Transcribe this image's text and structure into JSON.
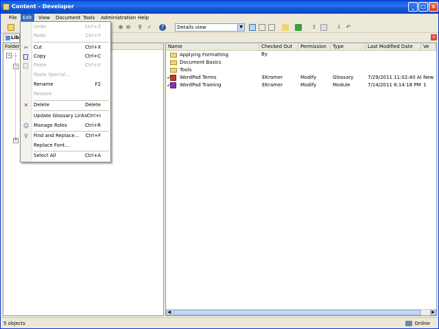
{
  "window": {
    "title": "Content - Developer"
  },
  "menubar": [
    "File",
    "Edit",
    "View",
    "Document",
    "Tools",
    "Administration",
    "Help"
  ],
  "toolbar": {
    "view_select": "Details view"
  },
  "tabs": {
    "active": "Lib"
  },
  "left_pane": {
    "header": "Folders"
  },
  "edit_menu": [
    {
      "label": "Undo",
      "shortcut": "Ctrl+Z",
      "enabled": false
    },
    {
      "label": "Redo",
      "shortcut": "Ctrl+Y",
      "enabled": false
    },
    {
      "label": "Cut",
      "shortcut": "Ctrl+X",
      "enabled": true
    },
    {
      "label": "Copy",
      "shortcut": "Ctrl+C",
      "enabled": true
    },
    {
      "label": "Paste",
      "shortcut": "Ctrl+V",
      "enabled": false
    },
    {
      "label": "Paste Special...",
      "shortcut": "",
      "enabled": false
    },
    {
      "label": "Rename",
      "shortcut": "F2",
      "enabled": true
    },
    {
      "label": "Restore",
      "shortcut": "",
      "enabled": false
    },
    {
      "label": "Delete",
      "shortcut": "Delete",
      "enabled": true
    },
    {
      "label": "Update Glossary Links",
      "shortcut": "Ctrl+I",
      "enabled": true
    },
    {
      "label": "Manage Roles",
      "shortcut": "Ctrl+R",
      "enabled": true
    },
    {
      "label": "Find and Replace...",
      "shortcut": "Ctrl+F",
      "enabled": true
    },
    {
      "label": "Replace Font...",
      "shortcut": "",
      "enabled": true
    },
    {
      "label": "Select All",
      "shortcut": "Ctrl+A",
      "enabled": true
    }
  ],
  "list": {
    "columns": [
      "Name",
      "Checked Out By",
      "Permission",
      "Type",
      "Last Modified Date",
      "Ve"
    ],
    "rows": [
      {
        "name": "Applying Formatting",
        "checked_out_by": "",
        "permission": "",
        "type": "",
        "modified": "",
        "version": "",
        "kind": "folder"
      },
      {
        "name": "Document Basics",
        "checked_out_by": "",
        "permission": "",
        "type": "",
        "modified": "",
        "version": "",
        "kind": "folder"
      },
      {
        "name": "Tools",
        "checked_out_by": "",
        "permission": "",
        "type": "",
        "modified": "",
        "version": "",
        "kind": "folder"
      },
      {
        "name": "WordPad Terms",
        "checked_out_by": "EKramer",
        "permission": "Modify",
        "type": "Glossary",
        "modified": "7/29/2011 11:02:40 AM",
        "version": "New",
        "kind": "glossary"
      },
      {
        "name": "WordPad Training",
        "checked_out_by": "EKramer",
        "permission": "Modify",
        "type": "Module",
        "modified": "7/14/2011 6:14:18 PM",
        "version": "1",
        "kind": "module"
      }
    ]
  },
  "status": {
    "count": "5 objects",
    "mode": "Online"
  }
}
